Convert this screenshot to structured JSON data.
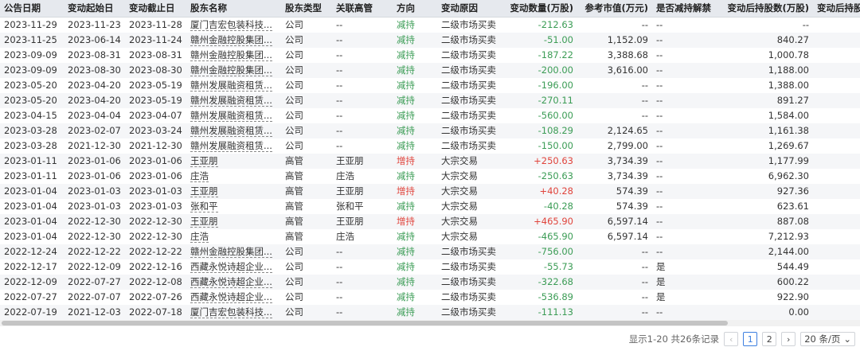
{
  "columns": [
    "公告日期",
    "变动起始日",
    "变动截止日",
    "股东名称",
    "股东类型",
    "关联高管",
    "方向",
    "变动原因",
    "变动数量(万股)",
    "参考市值(万元)",
    "是否减持解禁",
    "变动后持股数(万股)",
    "变动后持股比"
  ],
  "rows": [
    [
      "2023-11-29",
      "2023-11-23",
      "2023-11-28",
      "厦门吉宏包装科技...",
      "公司",
      "--",
      "减持",
      "二级市场买卖",
      "-212.63",
      "--",
      "--",
      "--"
    ],
    [
      "2023-11-25",
      "2023-06-14",
      "2023-11-24",
      "赣州金融控股集团...",
      "公司",
      "--",
      "减持",
      "二级市场买卖",
      "-51.00",
      "1,152.09",
      "--",
      "840.27"
    ],
    [
      "2023-09-09",
      "2023-08-31",
      "2023-08-31",
      "赣州金融控股集团...",
      "公司",
      "--",
      "减持",
      "二级市场买卖",
      "-187.22",
      "3,388.68",
      "--",
      "1,000.78"
    ],
    [
      "2023-09-09",
      "2023-08-30",
      "2023-08-30",
      "赣州金融控股集团...",
      "公司",
      "--",
      "减持",
      "二级市场买卖",
      "-200.00",
      "3,616.00",
      "--",
      "1,188.00"
    ],
    [
      "2023-05-20",
      "2023-04-20",
      "2023-05-19",
      "赣州发展融资租赁...",
      "公司",
      "--",
      "减持",
      "二级市场买卖",
      "-196.00",
      "--",
      "--",
      "1,388.00"
    ],
    [
      "2023-05-20",
      "2023-04-20",
      "2023-05-19",
      "赣州发展融资租赁...",
      "公司",
      "--",
      "减持",
      "二级市场买卖",
      "-270.11",
      "--",
      "--",
      "891.27"
    ],
    [
      "2023-04-15",
      "2023-04-04",
      "2023-04-07",
      "赣州发展融资租赁...",
      "公司",
      "--",
      "减持",
      "二级市场买卖",
      "-560.00",
      "--",
      "--",
      "1,584.00"
    ],
    [
      "2023-03-28",
      "2023-02-07",
      "2023-03-24",
      "赣州发展融资租赁...",
      "公司",
      "--",
      "减持",
      "二级市场买卖",
      "-108.29",
      "2,124.65",
      "--",
      "1,161.38"
    ],
    [
      "2023-03-28",
      "2021-12-30",
      "2021-12-30",
      "赣州发展融资租赁...",
      "公司",
      "--",
      "减持",
      "二级市场买卖",
      "-150.00",
      "2,799.00",
      "--",
      "1,269.67"
    ],
    [
      "2023-01-11",
      "2023-01-06",
      "2023-01-06",
      "王亚朋",
      "高管",
      "王亚朋",
      "增持",
      "大宗交易",
      "+250.63",
      "3,734.39",
      "--",
      "1,177.99"
    ],
    [
      "2023-01-11",
      "2023-01-06",
      "2023-01-06",
      "庄浩",
      "高管",
      "庄浩",
      "减持",
      "大宗交易",
      "-250.63",
      "3,734.39",
      "--",
      "6,962.30"
    ],
    [
      "2023-01-04",
      "2023-01-03",
      "2023-01-03",
      "王亚朋",
      "高管",
      "王亚朋",
      "增持",
      "大宗交易",
      "+40.28",
      "574.39",
      "--",
      "927.36"
    ],
    [
      "2023-01-04",
      "2023-01-03",
      "2023-01-03",
      "张和平",
      "高管",
      "张和平",
      "减持",
      "大宗交易",
      "-40.28",
      "574.39",
      "--",
      "623.61"
    ],
    [
      "2023-01-04",
      "2022-12-30",
      "2022-12-30",
      "王亚朋",
      "高管",
      "王亚朋",
      "增持",
      "大宗交易",
      "+465.90",
      "6,597.14",
      "--",
      "887.08"
    ],
    [
      "2023-01-04",
      "2022-12-30",
      "2022-12-30",
      "庄浩",
      "高管",
      "庄浩",
      "减持",
      "大宗交易",
      "-465.90",
      "6,597.14",
      "--",
      "7,212.93"
    ],
    [
      "2022-12-24",
      "2022-12-22",
      "2022-12-22",
      "赣州金融控股集团...",
      "公司",
      "--",
      "减持",
      "二级市场买卖",
      "-756.00",
      "--",
      "--",
      "2,144.00"
    ],
    [
      "2022-12-17",
      "2022-12-09",
      "2022-12-16",
      "西藏永悦诗超企业...",
      "公司",
      "--",
      "减持",
      "二级市场买卖",
      "-55.73",
      "--",
      "是",
      "544.49"
    ],
    [
      "2022-12-09",
      "2022-07-27",
      "2022-12-08",
      "西藏永悦诗超企业...",
      "公司",
      "--",
      "减持",
      "二级市场买卖",
      "-322.68",
      "--",
      "是",
      "600.22"
    ],
    [
      "2022-07-27",
      "2022-07-07",
      "2022-07-26",
      "西藏永悦诗超企业...",
      "公司",
      "--",
      "减持",
      "二级市场买卖",
      "-536.89",
      "--",
      "是",
      "922.90"
    ],
    [
      "2022-07-19",
      "2021-12-03",
      "2022-07-18",
      "厦门吉宏包装科技...",
      "公司",
      "--",
      "减持",
      "二级市场买卖",
      "-111.13",
      "--",
      "--",
      "0.00"
    ]
  ],
  "colors": {
    "increase": "#e0443c",
    "decrease": "#3b9c55",
    "accent": "#3d7fe0"
  },
  "pager": {
    "summary": "显示1-20 共26条记录",
    "prev_icon": "‹",
    "pages": [
      "1",
      "2"
    ],
    "next_icon": "›",
    "page_size": "20 条/页",
    "dropdown_icon": "⌄"
  }
}
